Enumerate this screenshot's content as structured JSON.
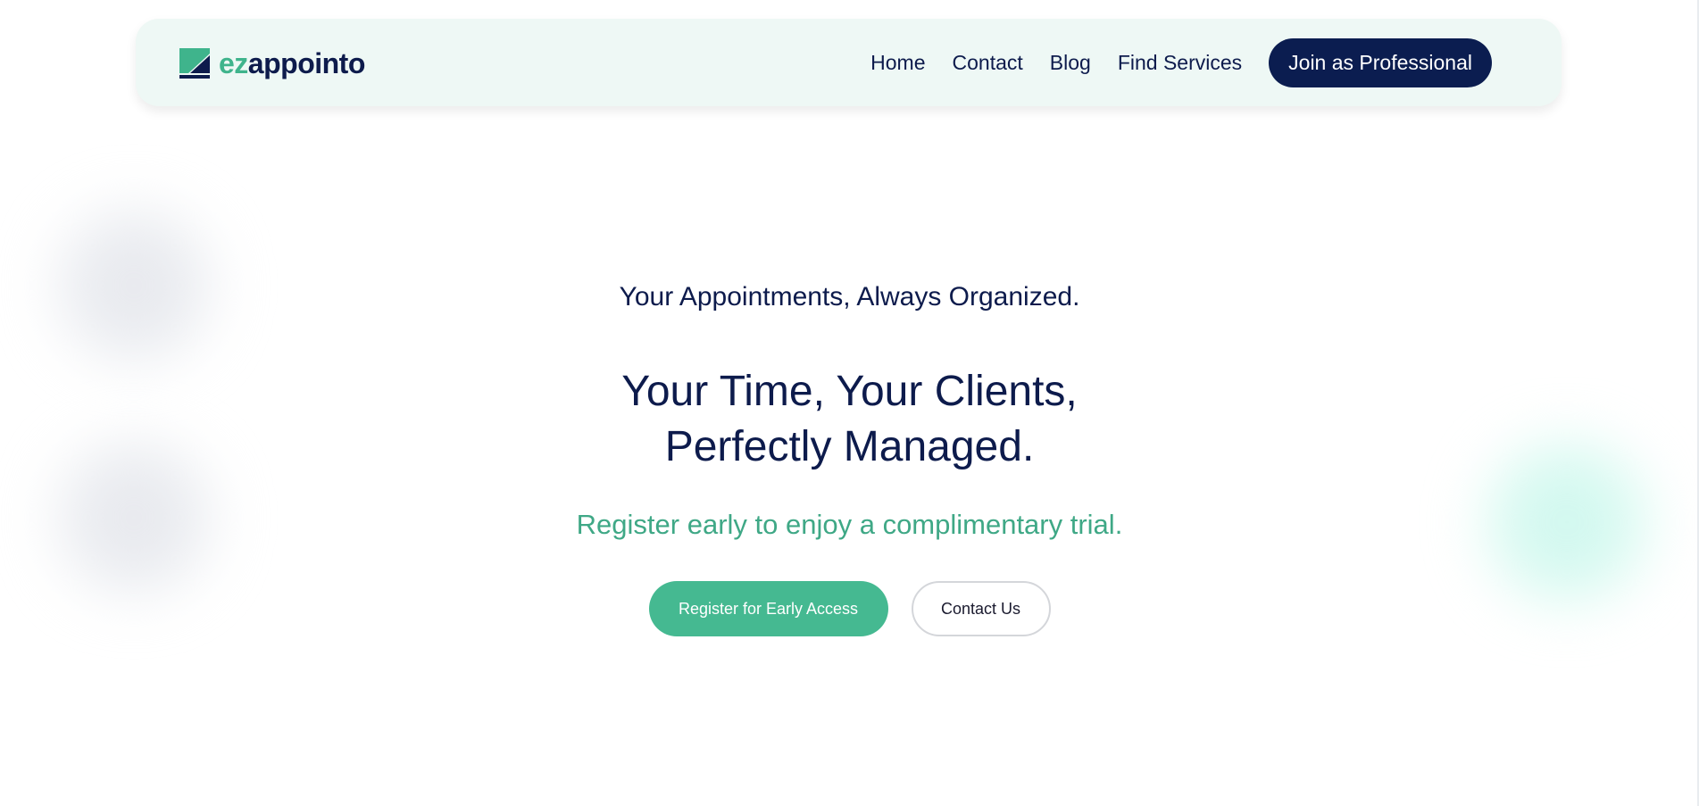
{
  "colors": {
    "brand_navy": "#0b1d50",
    "brand_green": "#45b991",
    "header_bg": "#eef8f5"
  },
  "header": {
    "logo": {
      "prefix": "ez",
      "rest": "appointo",
      "icon": "ezappointo-logo-mark"
    },
    "nav": [
      {
        "label": "Home"
      },
      {
        "label": "Contact"
      },
      {
        "label": "Blog"
      },
      {
        "label": "Find Services"
      }
    ],
    "join_label": "Join as Professional"
  },
  "hero": {
    "tagline": "Your Appointments, Always Organized.",
    "headline_line1": "Your Time, Your Clients,",
    "headline_line2": "Perfectly Managed.",
    "subline": "Register early to enjoy a complimentary trial.",
    "primary_cta": "Register for Early Access",
    "secondary_cta": "Contact Us"
  }
}
